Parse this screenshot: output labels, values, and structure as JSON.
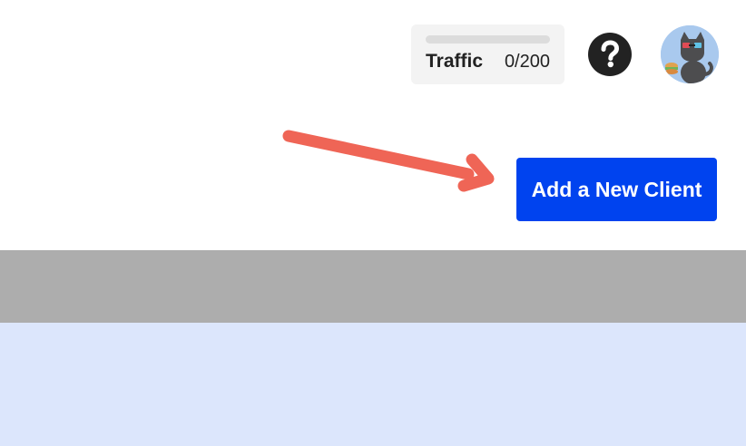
{
  "header": {
    "traffic": {
      "label": "Traffic",
      "value_text": "0/200",
      "used": 0,
      "limit": 200
    },
    "help": {
      "icon": "question-circle-icon"
    },
    "avatar": {
      "icon": "cat-avatar-icon"
    }
  },
  "actions": {
    "add_client_label": "Add a New Client"
  },
  "annotation": {
    "icon": "arrow-annotation-icon",
    "color": "#ef6556"
  },
  "colors": {
    "accent": "#0043ef",
    "band": "#adadad",
    "panel": "#dce6fc"
  }
}
